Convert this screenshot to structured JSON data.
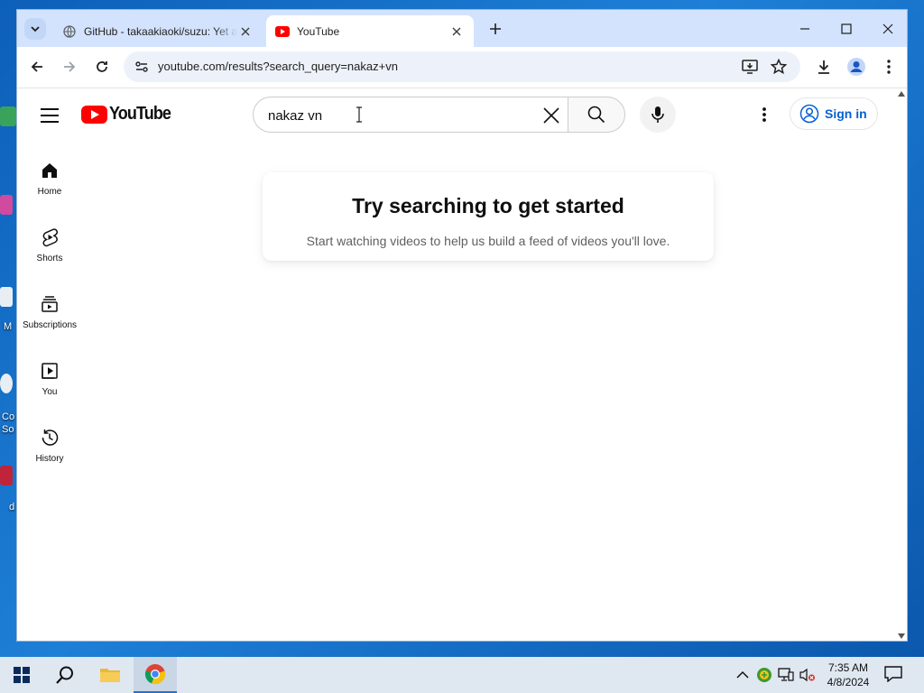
{
  "desktop": {
    "labels": [
      "M",
      "Co",
      "So",
      "d"
    ]
  },
  "browser": {
    "tabs": [
      {
        "title": "GitHub - takaakiaoki/suzu: Yet another",
        "active": false
      },
      {
        "title": "YouTube",
        "active": true
      }
    ],
    "url": "youtube.com/results?search_query=nakaz+vn"
  },
  "youtube": {
    "search": {
      "value": "nakaz vn",
      "placeholder": "Search"
    },
    "signin_label": "Sign in",
    "sidebar": [
      {
        "label": "Home",
        "icon": "home-icon"
      },
      {
        "label": "Shorts",
        "icon": "shorts-icon"
      },
      {
        "label": "Subscriptions",
        "icon": "subscriptions-icon"
      },
      {
        "label": "You",
        "icon": "you-icon"
      },
      {
        "label": "History",
        "icon": "history-icon"
      }
    ],
    "prompt": {
      "title": "Try searching to get started",
      "subtitle": "Start watching videos to help us build a feed of videos you'll love."
    },
    "brand_color": "#ff0000",
    "link_color": "#065fd4"
  },
  "taskbar": {
    "time": "7:35 AM",
    "date": "4/8/2024"
  }
}
